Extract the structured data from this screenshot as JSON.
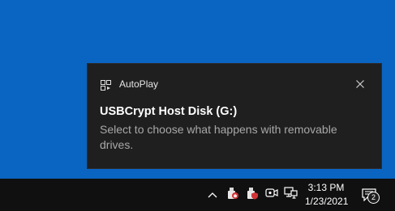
{
  "notification": {
    "app_name": "AutoPlay",
    "title": "USBCrypt Host Disk (G:)",
    "message": "Select to choose what happens with removable drives.",
    "app_icon": "autoplay-icon",
    "close_icon": "close-icon"
  },
  "taskbar": {
    "tray_icons": [
      "chevron-up-icon",
      "usb-drive-icon",
      "usb-drive-shield-icon",
      "security-shield-icon",
      "meet-now-icon",
      "network-icon"
    ],
    "clock": {
      "time": "3:13 PM",
      "date": "1/23/2021"
    },
    "action_center_count": "2"
  },
  "colors": {
    "desktop": "#0a64c2",
    "toast_bg": "#1f1f1f",
    "taskbar_bg": "#101010",
    "shield_red": "#d13438"
  }
}
